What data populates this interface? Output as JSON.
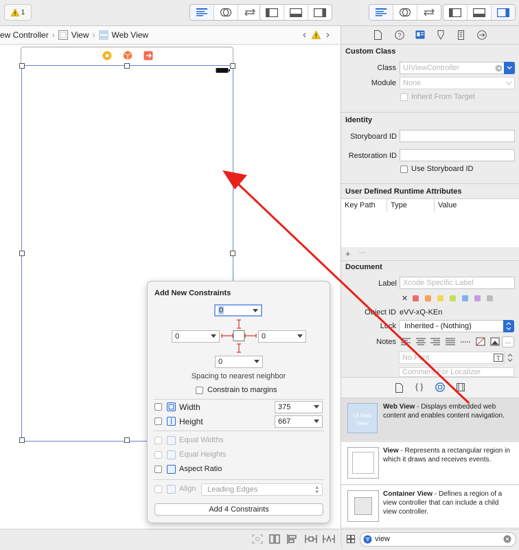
{
  "toolbar": {
    "warning_count": "1",
    "editor_icons": [
      "standard-editor-icon",
      "assistant-editor-icon",
      "version-editor-icon"
    ],
    "panel_icons": [
      "navigator-toggle-icon",
      "debug-area-toggle-icon",
      "utilities-toggle-icon"
    ]
  },
  "jumpbar": {
    "items": [
      "ew Controller",
      "View",
      "Web View"
    ]
  },
  "constraints_popover": {
    "title": "Add New Constraints",
    "top_value": "0",
    "left_value": "0",
    "right_value": "0",
    "bottom_value": "0",
    "spacing_label": "Spacing to nearest neighbor",
    "constrain_margins_label": "Constrain to margins",
    "width_label": "Width",
    "width_value": "375",
    "height_label": "Height",
    "height_value": "667",
    "equal_widths_label": "Equal Widths",
    "equal_heights_label": "Equal Heights",
    "aspect_ratio_label": "Aspect Ratio",
    "align_label": "Align",
    "align_value": "Leading Edges",
    "add_button_label": "Add 4 Constraints"
  },
  "inspector": {
    "custom_class": {
      "heading": "Custom Class",
      "class_label": "Class",
      "class_placeholder": "UIViewController",
      "module_label": "Module",
      "module_placeholder": "None",
      "inherit_label": "Inherit From Target"
    },
    "identity": {
      "heading": "Identity",
      "storyboard_id_label": "Storyboard ID",
      "restoration_id_label": "Restoration ID",
      "use_storyboard_id_label": "Use Storyboard ID"
    },
    "runtime_attributes": {
      "heading": "User Defined Runtime Attributes",
      "columns": [
        "Key Path",
        "Type",
        "Value"
      ],
      "add_symbol": "+",
      "remove_symbol": "—"
    },
    "document": {
      "heading": "Document",
      "label_label": "Label",
      "label_placeholder": "Xcode Specific Label",
      "object_id_label": "Object ID",
      "object_id_value": "eVV-xQ-KEn",
      "lock_label": "Lock",
      "lock_value": "Inherited - (Nothing)",
      "notes_label": "Notes",
      "font_placeholder": "No Font",
      "comment_placeholder": "Comment For Localizer",
      "swatch_colors": [
        "#ee6b6b",
        "#f3a35c",
        "#f0d95a",
        "#c8df5a",
        "#7fb2ee",
        "#c69be6",
        "#bdbdbd"
      ]
    }
  },
  "library": {
    "items": [
      {
        "name": "Web View",
        "desc": " - Displays embedded web content and enables content navigation.",
        "thumb_text": "UI Web View"
      },
      {
        "name": "View",
        "desc": " - Represents a rectangular region in which it draws and receives events."
      },
      {
        "name": "Container View",
        "desc": " - Defines a region of a view controller that can include a child view controller."
      }
    ],
    "filter_value": "view"
  },
  "colors": {
    "accent": "#2a6dd0",
    "selection_border": "#6c7fd8",
    "annotation_arrow": "#e8211b",
    "constraint_red": "#d33a2c"
  }
}
